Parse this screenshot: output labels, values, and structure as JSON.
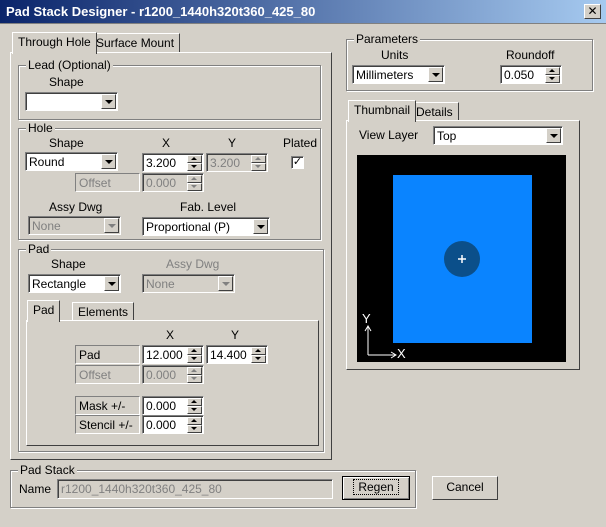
{
  "window": {
    "title": "Pad Stack Designer - r1200_1440h320t360_425_80",
    "close_glyph": "✕"
  },
  "tabs_left": [
    {
      "label": "Through Hole"
    },
    {
      "label": "Surface Mount"
    }
  ],
  "lead": {
    "legend": "Lead (Optional)",
    "shape_label": "Shape",
    "shape_value": ""
  },
  "hole": {
    "legend": "Hole",
    "shape_label": "Shape",
    "x_label": "X",
    "y_label": "Y",
    "plated_label": "Plated",
    "shape_value": "Round",
    "x_value": "3.200",
    "y_value": "3.200",
    "plated_checked": "✓",
    "offset_label": "Offset",
    "offset_value": "0.000",
    "assy_label": "Assy Dwg",
    "assy_value": "None",
    "fab_label": "Fab. Level",
    "fab_value": "Proportional (P)"
  },
  "pad": {
    "legend": "Pad",
    "shape_label": "Shape",
    "shape_value": "Rectangle",
    "assy_label": "Assy Dwg",
    "assy_value": "None",
    "tabs": [
      {
        "label": "Pad"
      },
      {
        "label": "Elements"
      }
    ],
    "x_label": "X",
    "y_label": "Y",
    "pad_label": "Pad",
    "pad_x": "12.000",
    "pad_y": "14.400",
    "offset_label": "Offset",
    "offset_value": "0.000",
    "mask_label": "Mask +/-",
    "mask_value": "0.000",
    "stencil_label": "Stencil +/-",
    "stencil_value": "0.000"
  },
  "padstack": {
    "legend": "Pad Stack",
    "name_label": "Name",
    "name_value": "r1200_1440h320t360_425_80",
    "regen_label": "Regen",
    "cancel_label": "Cancel"
  },
  "parameters": {
    "legend": "Parameters",
    "units_label": "Units",
    "units_value": "Millimeters",
    "roundoff_label": "Roundoff",
    "roundoff_value": "0.050"
  },
  "thumbnail": {
    "tabs": [
      {
        "label": "Thumbnail"
      },
      {
        "label": "Details"
      }
    ],
    "view_layer_label": "View Layer",
    "view_layer_value": "Top",
    "axis_y": "Y",
    "axis_x": "X",
    "colors": {
      "pad": "#0a84ff",
      "hole": "#0b4f8a",
      "background": "#000000"
    }
  }
}
